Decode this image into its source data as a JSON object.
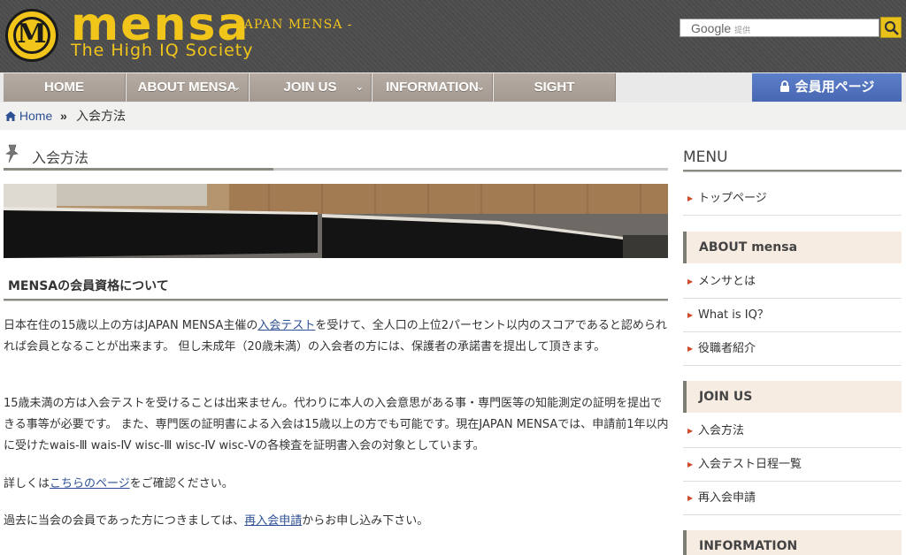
{
  "header": {
    "logo_word": "mensa",
    "logo_subtitle": "- JAPAN MENSA -",
    "logo_tagline": "The High IQ Society",
    "search_brand": "Google",
    "search_provided": "提供",
    "accent_color": "#f2c51a"
  },
  "nav": {
    "items": [
      {
        "label": "HOME",
        "has_dropdown": false
      },
      {
        "label": "ABOUT MENSA",
        "has_dropdown": true
      },
      {
        "label": "JOIN US",
        "has_dropdown": true
      },
      {
        "label": "INFORMATION",
        "has_dropdown": true
      },
      {
        "label": "SIGHT",
        "has_dropdown": false
      }
    ],
    "member_button_label": "会員用ページ",
    "member_button_icon": "lock-icon"
  },
  "breadcrumb": {
    "home": "Home",
    "separator": "»",
    "current": "入会方法"
  },
  "main": {
    "page_title": "入会方法",
    "section_heading": "MENSAの会員資格について",
    "paragraphs": {
      "p1_before": "日本在住の15歳以上の方はJAPAN MENSA主催の",
      "p1_link": "入会テスト",
      "p1_after": "を受けて、全人口の上位2パーセント以内のスコアであると認められれば会員となることが出来ます。 但し未成年（20歳未満）の入会者の方には、保護者の承諾書を提出して頂きます。",
      "p2": "15歳未満の方は入会テストを受けることは出来ません。代わりに本人の入会意思がある事・専門医等の知能測定の証明を提出できる事等が必要です。 また、専門医の証明書による入会は15歳以上の方でも可能です。現在JAPAN MENSAでは、申請前1年以内に受けたwais-Ⅲ wais-Ⅳ wisc-Ⅲ wisc-Ⅳ wisc-Ⅴの各検査を証明書入会の対象としています。",
      "p3_before": "詳しくは",
      "p3_link": "こちらのページ",
      "p3_after": "をご確認ください。",
      "p4_before": "過去に当会の会員であった方につきましては、",
      "p4_link": "再入会申請",
      "p4_after": "からお申し込み下さい。"
    }
  },
  "sidebar": {
    "title": "MENU",
    "top_item": "トップページ",
    "groups": [
      {
        "heading": "ABOUT mensa",
        "items": [
          "メンサとは",
          "What is IQ？",
          "役職者紹介"
        ]
      },
      {
        "heading": "JOIN US",
        "items": [
          "入会方法",
          "入会テスト日程一覧",
          "再入会申請"
        ]
      },
      {
        "heading": "INFORMATION",
        "items": []
      }
    ]
  }
}
